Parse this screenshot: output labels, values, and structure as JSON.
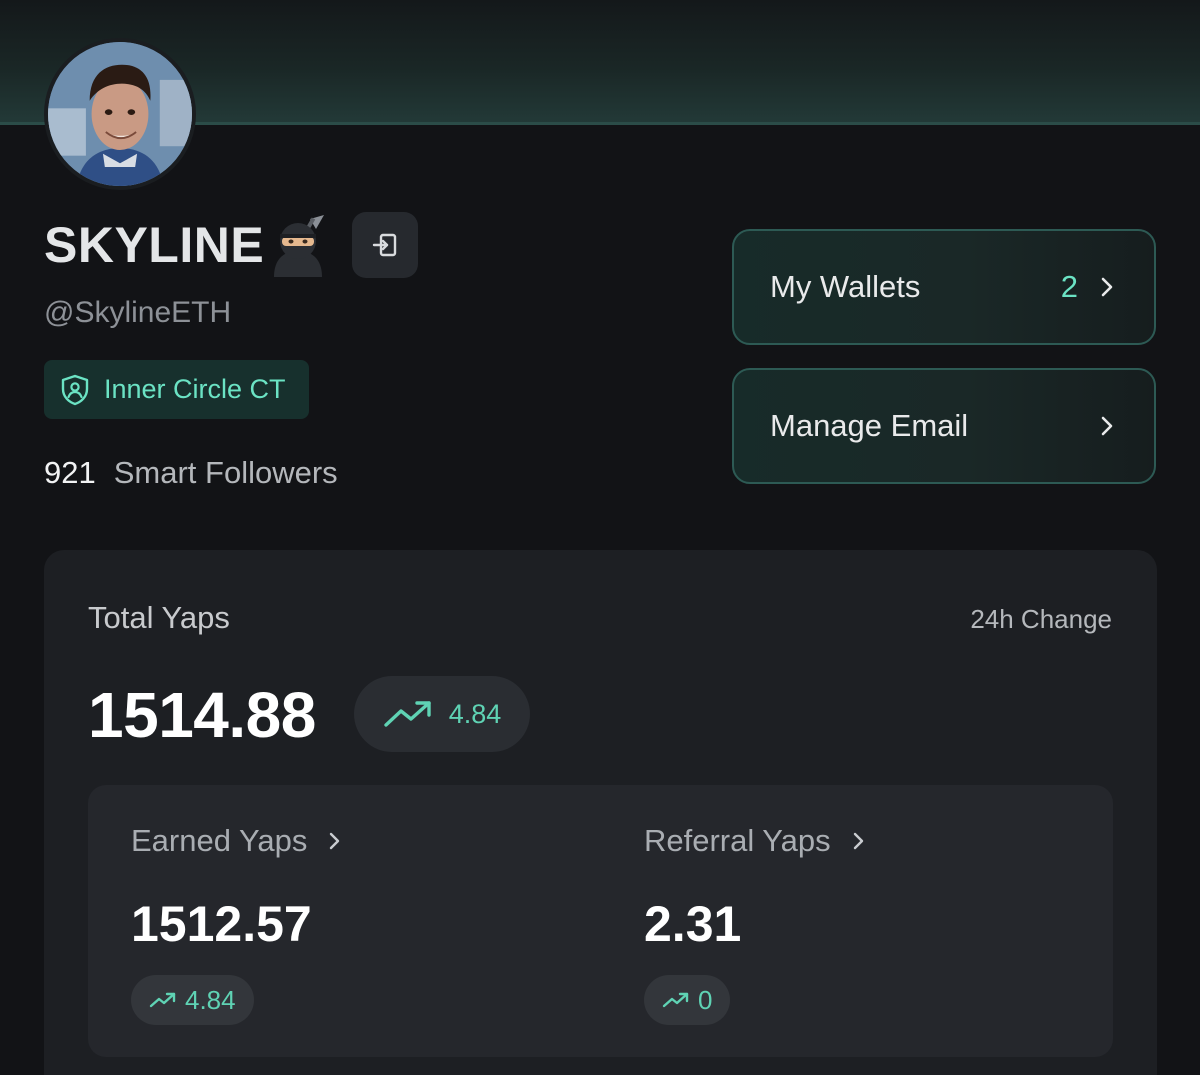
{
  "profile": {
    "name": "SKYLINE",
    "name_emoji_icon": "ninja-emoji-icon",
    "handle": "@SkylineETH",
    "badge_label": "Inner Circle CT",
    "badge_icon": "shield-user-icon",
    "logout_icon": "logout-icon",
    "followers_count": "921",
    "followers_label": "Smart Followers"
  },
  "actions": {
    "wallets_label": "My Wallets",
    "wallets_count": "2",
    "email_label": "Manage Email"
  },
  "stats": {
    "title": "Total Yaps",
    "change_label": "24h Change",
    "total": "1514.88",
    "total_change": "4.84",
    "earned": {
      "label": "Earned Yaps",
      "value": "1512.57",
      "change": "4.84"
    },
    "referral": {
      "label": "Referral Yaps",
      "value": "2.31",
      "change": "0"
    }
  },
  "colors": {
    "accent": "#6be3c4",
    "positive": "#5fd3b4",
    "background": "#121316",
    "card": "#1d1f23"
  }
}
